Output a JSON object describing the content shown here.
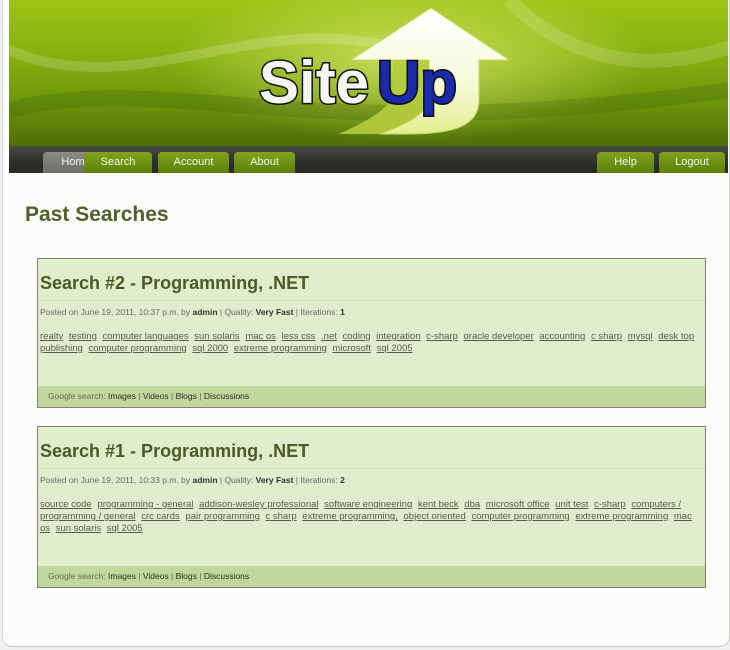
{
  "site": {
    "logo_text_a": "Site",
    "logo_text_b": "Up"
  },
  "nav": {
    "left": [
      "Home",
      "Search",
      "Account",
      "About"
    ],
    "right": [
      "Help",
      "Logout"
    ]
  },
  "page": {
    "title": "Past Searches"
  },
  "searches": [
    {
      "title": "Search #2 - Programming, .NET",
      "meta_prefix": "Posted on June 19, 2011, 10:37 p.m. by ",
      "author": "admin",
      "quality_label": " | Quality: ",
      "quality": "Very Fast",
      "iterations_label": " | Iterations: ",
      "iterations": "1",
      "tags": [
        "realty",
        "testing",
        "computer languages",
        "sun solaris",
        "mac os",
        "less css",
        ".net",
        "coding",
        "integration",
        "c-sharp",
        "oracle developer",
        "accounting",
        "c sharp",
        "mysql",
        "desk top publishing",
        "computer programming",
        "sql 2000",
        "extreme programming",
        "microsoft",
        "sql 2005"
      ],
      "google_label": "Google search: ",
      "google_links": [
        "Images",
        "Videos",
        "Blogs",
        "Discussions"
      ]
    },
    {
      "title": "Search #1 - Programming, .NET",
      "meta_prefix": "Posted on June 19, 2011, 10:33 p.m. by ",
      "author": "admin",
      "quality_label": " | Quality: ",
      "quality": "Very Fast",
      "iterations_label": " | Iterations: ",
      "iterations": "2",
      "tags": [
        "source code",
        "programming - general",
        "addison-wesley professional",
        "software engineering",
        "kent beck",
        "dba",
        "microsoft office",
        "unit test",
        "c-sharp",
        "computers / programming / general",
        "crc cards",
        "pair programming",
        "c sharp",
        "extreme programming,",
        "object oriented",
        "computer programming",
        "extreme programming",
        "mac os",
        "sun solaris",
        "sql 2005"
      ],
      "google_label": "Google search: ",
      "google_links": [
        "Images",
        "Videos",
        "Blogs",
        "Discussions"
      ]
    }
  ],
  "colors": {
    "accent_green": "#87b20f",
    "panel_bg": "#e0edcc",
    "footer_bg": "#bfd79b",
    "title_green": "#4f6028"
  }
}
